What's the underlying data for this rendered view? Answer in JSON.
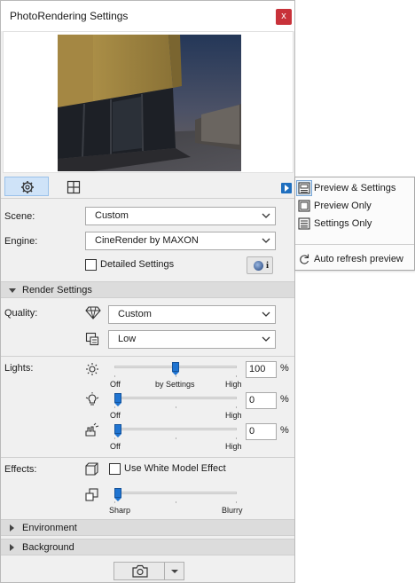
{
  "window": {
    "title": "PhotoRendering Settings",
    "close_label": "x"
  },
  "mode_buttons": [
    {
      "name": "settings-mode-button",
      "icon": "gear-icon",
      "active": true
    },
    {
      "name": "preview-mode-button",
      "icon": "crop-frame-icon",
      "active": false
    }
  ],
  "scene": {
    "label": "Scene:",
    "value": "Custom"
  },
  "engine": {
    "label": "Engine:",
    "value": "CineRender by MAXON"
  },
  "detailed_settings": {
    "label": "Detailed Settings",
    "checked": false,
    "info_label": "i"
  },
  "render_settings": {
    "header": "Render Settings",
    "quality_label": "Quality:",
    "quality_value": "Custom",
    "resolution_value": "Low"
  },
  "lights": {
    "label": "Lights:",
    "sun": {
      "icon": "sun-icon",
      "value": "100",
      "unit": "%",
      "min_label": "Off",
      "mid_label": "by Settings",
      "max_label": "High",
      "level": 0.5
    },
    "lamp": {
      "icon": "light-bulb-icon",
      "value": "0",
      "unit": "%",
      "min_label": "Off",
      "max_label": "High",
      "level": 0.0
    },
    "environment": {
      "icon": "hand-light-icon",
      "value": "0",
      "unit": "%",
      "min_label": "Off",
      "max_label": "High",
      "level": 0.0
    }
  },
  "effects": {
    "label": "Effects:",
    "white_model_label": "Use White Model Effect",
    "white_model_checked": false,
    "blur": {
      "min_label": "Sharp",
      "max_label": "Blurry",
      "level": 0.0
    }
  },
  "sections": {
    "environment": "Environment",
    "background": "Background"
  },
  "popup_menu": {
    "items": [
      "Preview & Settings",
      "Preview Only",
      "Settings Only"
    ],
    "selected": "Preview & Settings",
    "auto_refresh": "Auto refresh preview"
  },
  "colors": {
    "accent": "#1f74d1",
    "close": "#c8323a",
    "panel": "#f0f0f0",
    "section": "#dcdcdc"
  }
}
